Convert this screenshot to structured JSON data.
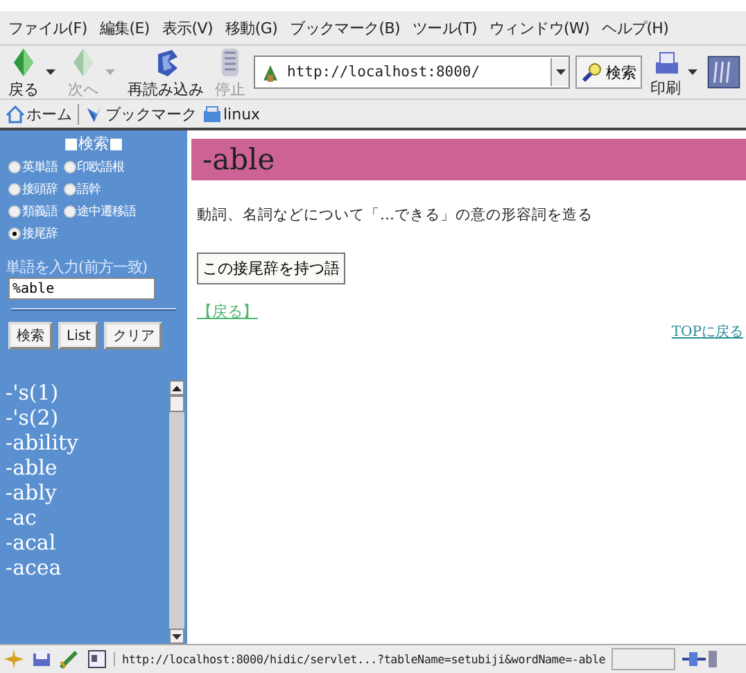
{
  "menu_bar": [
    "ファイル(F)",
    "編集(E)",
    "表示(V)",
    "移動(G)",
    "ブックマーク(B)",
    "ツール(T)",
    "ウィンドウ(W)",
    "ヘルプ(H)"
  ],
  "toolbar": {
    "buttons": [
      {
        "label": "戻る",
        "kind": "back",
        "disabled": false,
        "caret": true
      },
      {
        "label": "次へ",
        "kind": "forward",
        "disabled": true,
        "caret": true
      },
      {
        "label": "再読み込み",
        "kind": "reload",
        "disabled": false,
        "caret": false
      },
      {
        "label": "停止",
        "kind": "stop",
        "disabled": true,
        "caret": false
      }
    ],
    "address": "http://localhost:8000/",
    "search_button": "検索",
    "print_button": {
      "label": "印刷",
      "caret": true
    }
  },
  "bookmarks_bar": [
    {
      "label": "ホーム",
      "kind": "home"
    },
    {
      "label": "ブックマーク",
      "kind": "bookmarks"
    },
    {
      "label": "linux",
      "kind": "folder"
    }
  ],
  "sidebar": {
    "heading": "■検索■",
    "options": [
      {
        "label": "英単語",
        "selected": false
      },
      {
        "label": "印欧語根",
        "selected": false
      },
      {
        "label": "接頭辞",
        "selected": false
      },
      {
        "label": "語幹",
        "selected": false
      },
      {
        "label": "類義語",
        "selected": false
      },
      {
        "label": "途中遷移語",
        "selected": false
      },
      {
        "label": "接尾辞",
        "selected": true
      }
    ],
    "input_label": "単語を入力(前方一致)",
    "input_value": "%able",
    "buttons": [
      "検索",
      "List",
      "クリア"
    ],
    "word_list": [
      "-'s(1)",
      "-'s(2)",
      "-ability",
      "-able",
      "-ably",
      "-ac",
      "-acal",
      "-acea"
    ]
  },
  "content": {
    "title": "-able",
    "description": "動詞、名詞などについて「…できる」の意の形容詞を造る",
    "words_button": "この接尾辞を持つ語",
    "back_link": "【戻る】",
    "top_link": "TOPに戻る"
  },
  "status_bar": {
    "url": "http://localhost:8000/hidic/servlet...?tableName=setubiji&wordName=-able"
  }
}
